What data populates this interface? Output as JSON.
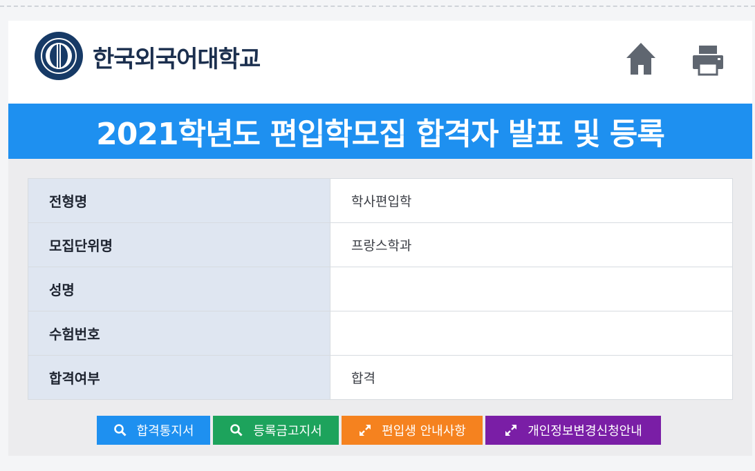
{
  "header": {
    "university_name": "한국외국어대학교",
    "logo_icon": "university-seal-icon",
    "home_icon": "home-icon",
    "print_icon": "print-icon"
  },
  "banner": {
    "title": "2021학년도 편입학모집 합격자 발표 및 등록"
  },
  "info_table": {
    "rows": [
      {
        "label": "전형명",
        "value": "학사편입학"
      },
      {
        "label": "모집단위명",
        "value": "프랑스학과"
      },
      {
        "label": "성명",
        "value": ""
      },
      {
        "label": "수험번호",
        "value": ""
      },
      {
        "label": "합격여부",
        "value": "합격"
      }
    ]
  },
  "actions": {
    "acceptance_letter": "합격통지서",
    "registration_notice": "등록금고지서",
    "transfer_guide": "편입생 안내사항",
    "privacy_change_guide": "개인정보변경신청안내"
  },
  "colors": {
    "banner_blue": "#1e90f0",
    "button_green": "#1da35c",
    "button_orange": "#f5821f",
    "button_purple": "#7a1ea6",
    "navy": "#173a66"
  }
}
